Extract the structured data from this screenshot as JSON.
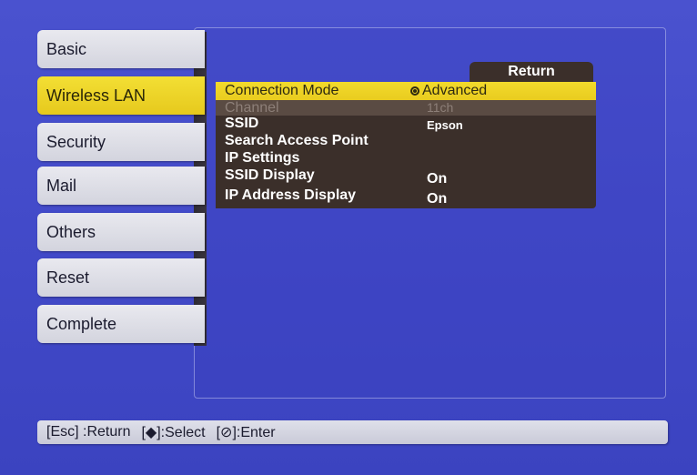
{
  "tabs": [
    {
      "label": "Basic"
    },
    {
      "label": "Wireless LAN"
    },
    {
      "label": "Security"
    },
    {
      "label": "Mail"
    },
    {
      "label": "Others"
    },
    {
      "label": "Reset"
    },
    {
      "label": "Complete"
    }
  ],
  "active_tab": "Wireless LAN",
  "return_label": "Return",
  "menu": [
    {
      "label": "Connection Mode",
      "value": "Advanced",
      "state": "selected",
      "icon": "radio-selected-icon"
    },
    {
      "label": "Channel",
      "value": "11ch",
      "state": "disabled"
    },
    {
      "label": "SSID",
      "value": "Epson"
    },
    {
      "label": "Search Access Point",
      "value": ""
    },
    {
      "label": "IP Settings",
      "value": ""
    },
    {
      "label": "SSID Display",
      "value": "On"
    },
    {
      "label": "IP Address Display",
      "value": "On"
    }
  ],
  "status_bar": {
    "esc": "[Esc] :Return",
    "select": "[◆]:Select",
    "enter": "[⊘]:Enter"
  },
  "colors": {
    "background": "#4149c8",
    "highlight": "#f2da2c",
    "menu_row": "#3b2f2a",
    "tab": "#e3e3ea"
  }
}
